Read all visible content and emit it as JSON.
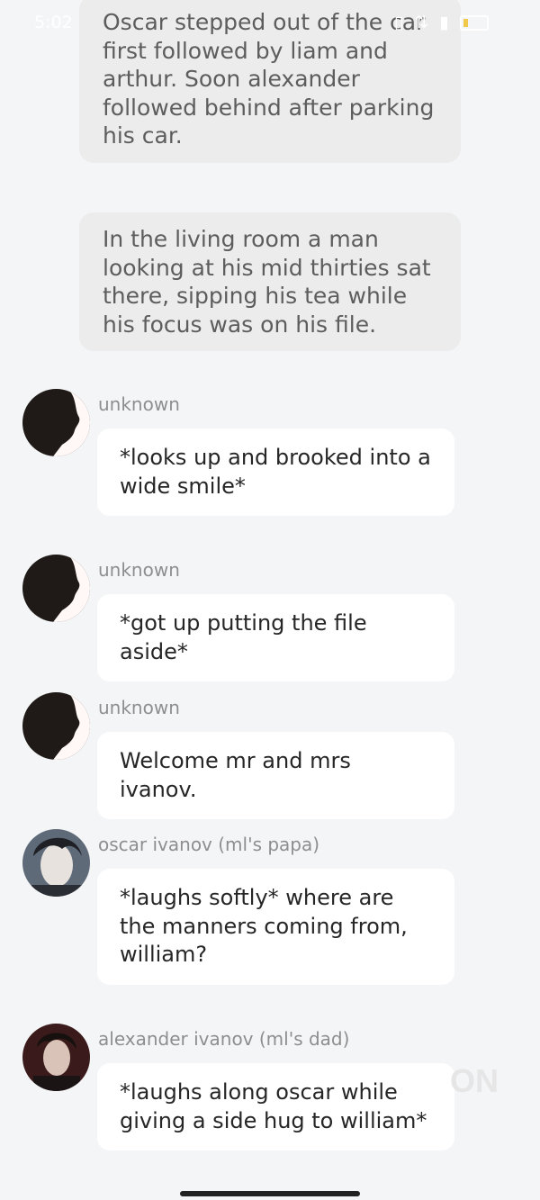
{
  "status_bar": {
    "time": "5:02",
    "icons": [
      "whatsapp-icon",
      "vibrate-icon",
      "network-icon",
      "signal-icon",
      "battery-icon"
    ]
  },
  "narrations": [
    "Oscar stepped out of the car first followed by liam and arthur. Soon alexander followed behind after parking his car.",
    "In the living room a man looking at his mid thirties sat there, sipping his tea while his focus was on his file."
  ],
  "messages": [
    {
      "sender": "unknown",
      "text": "*looks up and brooked into a wide smile*"
    },
    {
      "sender": "unknown",
      "text": "*got up putting the file aside*"
    },
    {
      "sender": "unknown",
      "text": "Welcome mr and mrs ivanov."
    },
    {
      "sender": "oscar ivanov (ml's papa)",
      "text": "*laughs softly* where are the manners coming from, william?"
    },
    {
      "sender": "alexander ivanov (ml's dad)",
      "text": "*laughs along oscar while giving a side hug to william*"
    }
  ],
  "watermark": "ON"
}
